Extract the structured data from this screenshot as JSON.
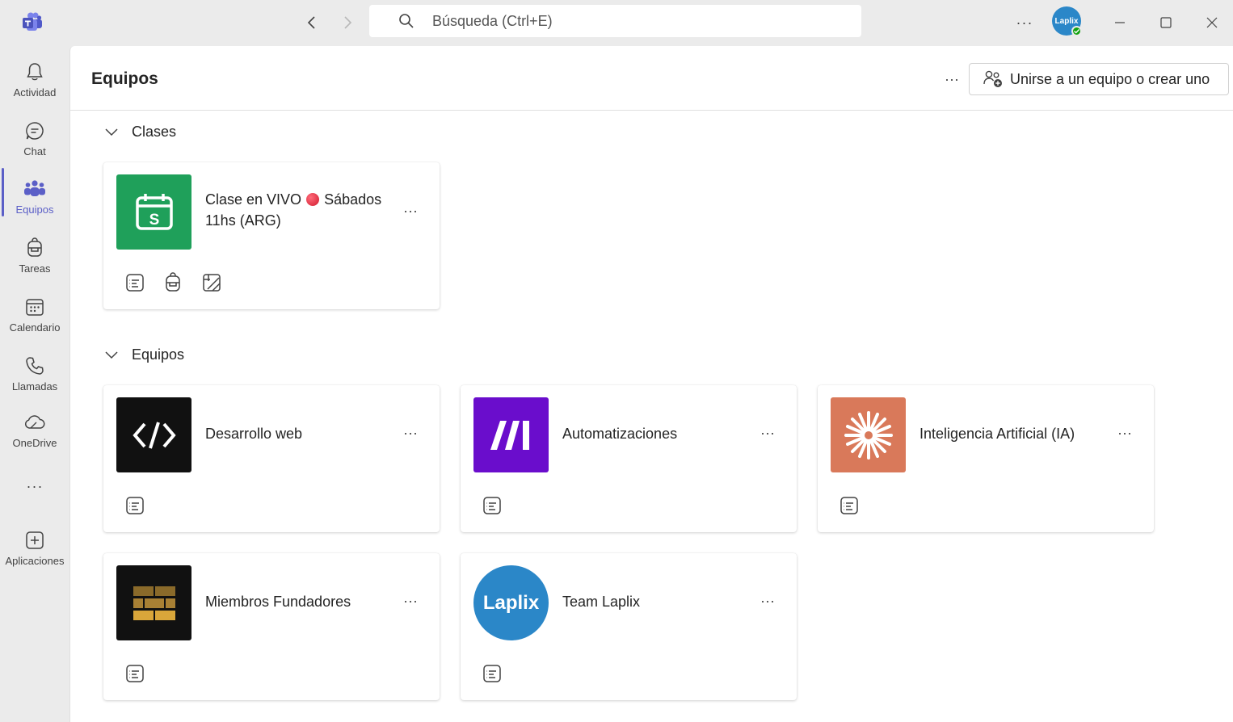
{
  "titlebar": {
    "search_placeholder": "Búsqueda (Ctrl+E)",
    "avatar_text": "Laplix",
    "more_label": "···"
  },
  "rail": {
    "items": [
      {
        "label": "Actividad",
        "icon": "bell-icon"
      },
      {
        "label": "Chat",
        "icon": "chat-icon"
      },
      {
        "label": "Equipos",
        "icon": "teams-icon",
        "active": true
      },
      {
        "label": "Tareas",
        "icon": "backpack-icon"
      },
      {
        "label": "Calendario",
        "icon": "calendar-icon"
      },
      {
        "label": "Llamadas",
        "icon": "phone-icon"
      },
      {
        "label": "OneDrive",
        "icon": "cloud-icon"
      },
      {
        "label": "···",
        "icon": "more-icon"
      },
      {
        "label": "Aplicaciones",
        "icon": "add-apps-icon"
      }
    ]
  },
  "header": {
    "title": "Equipos",
    "more_label": "···",
    "join_button": "Unirse a un equipo o crear uno"
  },
  "sections": {
    "classes": {
      "label": "Clases",
      "cards": [
        {
          "title_line1": "Clase en VIVO",
          "title_after_dot": "Sábados",
          "title_line2": "11hs (ARG)",
          "more": "···",
          "tile_color": "#1fa05a"
        }
      ]
    },
    "teams": {
      "label": "Equipos",
      "cards": [
        {
          "title": "Desarrollo web",
          "more": "···",
          "tile_color": "#111111"
        },
        {
          "title": "Automatizaciones",
          "more": "···",
          "tile_color": "#6a0dcc"
        },
        {
          "title": "Inteligencia Artificial (IA)",
          "more": "···",
          "tile_color": "#d9795a"
        },
        {
          "title": "Miembros Fundadores",
          "more": "···",
          "tile_color": "#111111"
        },
        {
          "title": "Team Laplix",
          "more": "···",
          "tile_color": "#2b87c8",
          "tile_text": "Laplix"
        }
      ]
    }
  },
  "colors": {
    "accent": "#5b5fc7",
    "status_available": "#13a10e"
  }
}
